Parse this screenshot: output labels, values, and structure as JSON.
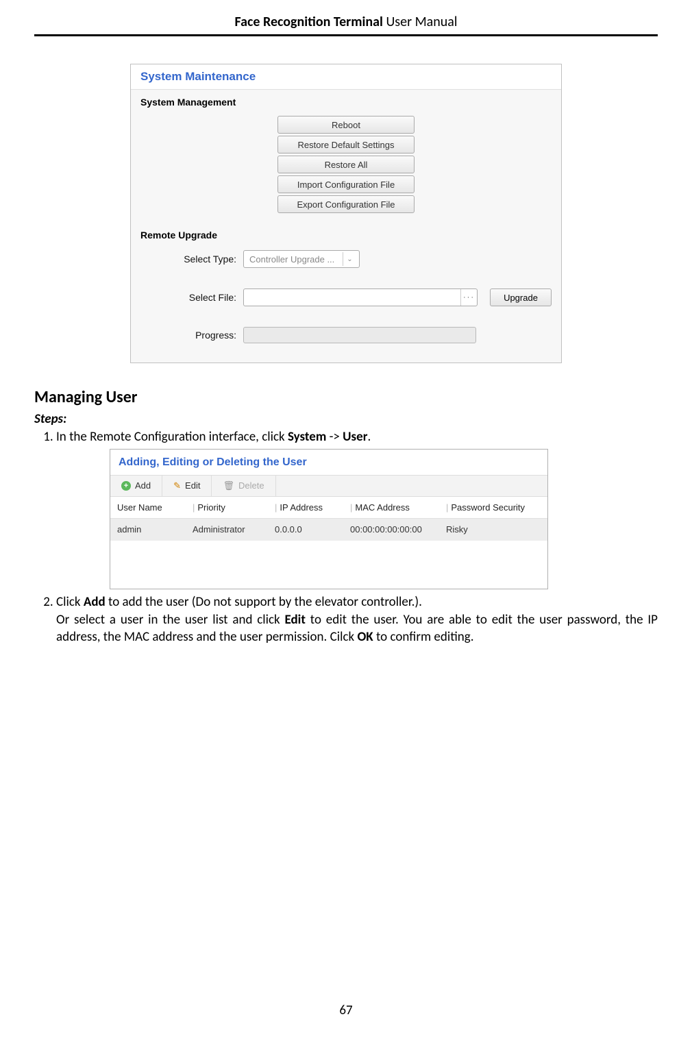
{
  "header": {
    "bold": "Face Recognition Terminal",
    "rest": "  User Manual"
  },
  "panel1": {
    "title": "System Maintenance",
    "section1": "System Management",
    "buttons": {
      "reboot": "Reboot",
      "restore_default": "Restore Default Settings",
      "restore_all": "Restore All",
      "import_cfg": "Import Configuration File",
      "export_cfg": "Export Configuration File"
    },
    "section2": "Remote Upgrade",
    "select_type_label": "Select Type:",
    "select_type_value": "Controller Upgrade ...",
    "select_file_label": "Select File:",
    "upgrade_btn": "Upgrade",
    "progress_label": "Progress:"
  },
  "doc": {
    "h2": "Managing User",
    "steps_label": "Steps:",
    "step1_a": "In the Remote Configuration interface, click ",
    "step1_b": "System",
    "step1_c": " -> ",
    "step1_d": "User",
    "step1_e": ".",
    "step2_a": "Click ",
    "step2_b": "Add",
    "step2_c": " to add the user (Do not support by the elevator controller.).",
    "step2_d": "Or select a user in the user list and click ",
    "step2_e": "Edit",
    "step2_f": " to edit the user. You are able to edit the user password, the IP address, the MAC address and the user permission. Cilck ",
    "step2_g": "OK",
    "step2_h": " to confirm editing."
  },
  "panel2": {
    "title": "Adding, Editing or Deleting the User",
    "add": "Add",
    "edit": "Edit",
    "delete": "Delete",
    "headers": {
      "user_name": "User Name",
      "priority": "Priority",
      "ip": "IP Address",
      "mac": "MAC Address",
      "pwd": "Password Security"
    },
    "row": {
      "user_name": "admin",
      "priority": "Administrator",
      "ip": "0.0.0.0",
      "mac": "00:00:00:00:00:00",
      "pwd": "Risky"
    }
  },
  "page_number": "67"
}
